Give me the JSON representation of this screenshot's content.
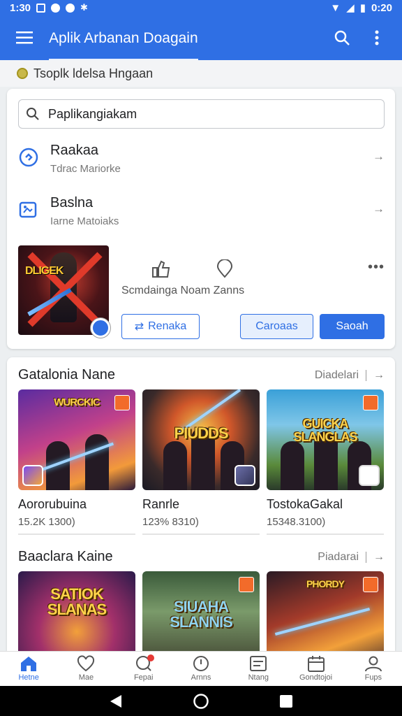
{
  "status_bar": {
    "time_left": "1:30",
    "time_right": "0:20"
  },
  "app_bar": {
    "title": "Aplik Arbanan Doagain"
  },
  "subheader": {
    "text": "Tsoplk ldelsa Hngaan"
  },
  "search": {
    "value": "Paplikangiakam"
  },
  "list": [
    {
      "title": "Raakaa",
      "subtitle": "Tdrac Mariorke"
    },
    {
      "title": "Baslna",
      "subtitle": "Iarne Matoiaks"
    }
  ],
  "promo": {
    "art_text": "DLIGEK",
    "caption": "Scmdainga Noam Zanns",
    "btn_left": "Renaka",
    "btn_mid": "Caroaas",
    "btn_right": "Saoah"
  },
  "section1": {
    "title": "Gatalonia Nane",
    "link": "Diadelari",
    "tiles": [
      {
        "name": "Aororubuina",
        "meta": "15.2K 1300)",
        "art_text": "WURCKIC"
      },
      {
        "name": "Ranrle",
        "meta": "123% 8310)",
        "art_text": "PIUDDS"
      },
      {
        "name": "TostokaGakal",
        "meta": "15348.3100)",
        "art_text": "GUICKA SLANGLAS"
      }
    ]
  },
  "section2": {
    "title": "Baaclara Kaine",
    "link": "Piadarai",
    "tiles": [
      {
        "art_text": "SATIOK SLANAS"
      },
      {
        "art_text": "SIUAHA SLANNIS"
      },
      {
        "art_text": "PHORDY"
      }
    ]
  },
  "bottom_nav": [
    {
      "label": "Hetne",
      "icon": "home-icon"
    },
    {
      "label": "Mae",
      "icon": "heart-icon"
    },
    {
      "label": "Fepai",
      "icon": "chat-icon"
    },
    {
      "label": "Arnns",
      "icon": "clock-icon"
    },
    {
      "label": "Ntang",
      "icon": "list-icon"
    },
    {
      "label": "Gondtojoi",
      "icon": "calendar-icon"
    },
    {
      "label": "Fups",
      "icon": "profile-icon"
    }
  ],
  "colors": {
    "primary": "#2f6fe4",
    "notification": "#e53935"
  }
}
